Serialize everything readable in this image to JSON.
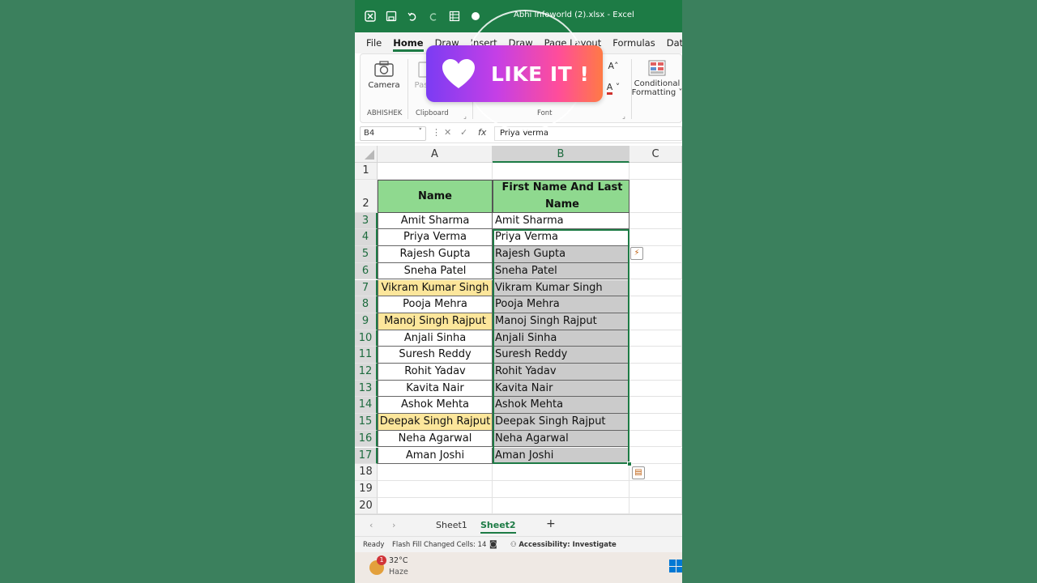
{
  "window": {
    "title": "Abhi Infoworld (2).xlsx  -  Excel",
    "titlebar_icons": [
      "excel-icon",
      "save-icon",
      "undo-icon",
      "redo-icon",
      "form-icon",
      "circle-icon"
    ]
  },
  "ribbon_tabs": [
    "File",
    "Home",
    "Draw",
    "Insert",
    "Draw",
    "Page Layout",
    "Formulas",
    "Data"
  ],
  "ribbon": {
    "camera_label": "Camera",
    "paste_label": "Paste",
    "group_abhishek": "ABHISHEK",
    "group_clipboard": "Clipboard",
    "group_font": "Font",
    "conditional_formatting_line1": "Conditional",
    "conditional_formatting_line2": "Formatting"
  },
  "overlay": {
    "like_text": "LIKE IT !",
    "colors": {
      "gradient_start": "#7b3cf3",
      "gradient_end": "#ff7a45"
    }
  },
  "formula_bar": {
    "name_box": "B4",
    "fx": "fx",
    "value": "Priya Verma"
  },
  "columns": [
    "A",
    "B",
    "C"
  ],
  "rows": [
    {
      "num": "1",
      "a": "",
      "b": ""
    },
    {
      "num": "2",
      "a": "Name",
      "b": "First Name And Last Name"
    },
    {
      "num": "3",
      "a": "Amit Sharma",
      "b": "Amit Sharma"
    },
    {
      "num": "4",
      "a": "Priya Verma",
      "b": "Priya Verma"
    },
    {
      "num": "5",
      "a": "Rajesh Gupta",
      "b": "Rajesh Gupta"
    },
    {
      "num": "6",
      "a": "Sneha Patel",
      "b": "Sneha Patel"
    },
    {
      "num": "7",
      "a": "Vikram Kumar Singh",
      "b": "Vikram Kumar Singh"
    },
    {
      "num": "8",
      "a": "Pooja Mehra",
      "b": "Pooja Mehra"
    },
    {
      "num": "9",
      "a": "Manoj Singh Rajput",
      "b": "Manoj Singh Rajput"
    },
    {
      "num": "10",
      "a": "Anjali Sinha",
      "b": "Anjali Sinha"
    },
    {
      "num": "11",
      "a": "Suresh Reddy",
      "b": "Suresh Reddy"
    },
    {
      "num": "12",
      "a": "Rohit Yadav",
      "b": "Rohit Yadav"
    },
    {
      "num": "13",
      "a": "Kavita Nair",
      "b": "Kavita Nair"
    },
    {
      "num": "14",
      "a": "Ashok Mehta",
      "b": "Ashok Mehta"
    },
    {
      "num": "15",
      "a": "Deepak Singh Rajput",
      "b": "Deepak Singh Rajput"
    },
    {
      "num": "16",
      "a": "Neha Agarwal",
      "b": "Neha Agarwal"
    },
    {
      "num": "17",
      "a": "Aman Joshi",
      "b": "Aman Joshi"
    },
    {
      "num": "18",
      "a": "",
      "b": ""
    },
    {
      "num": "19",
      "a": "",
      "b": ""
    },
    {
      "num": "20",
      "a": "",
      "b": ""
    }
  ],
  "highlighted_rows": [
    "7",
    "9",
    "15"
  ],
  "sheets": [
    "Sheet1",
    "Sheet2"
  ],
  "active_sheet": "Sheet2",
  "add_sheet": "+",
  "status": {
    "ready": "Ready",
    "flash_fill": "Flash Fill Changed Cells: 14",
    "accessibility": "Accessibility: Investigate"
  },
  "taskbar": {
    "temperature": "32°C",
    "condition": "Haze",
    "badge": "1"
  },
  "colors": {
    "excel_green": "#1d7b45",
    "header_fill": "#8fd98f",
    "highlight_yellow": "#fce69b",
    "flash_fill_gray": "#cbcbcb"
  }
}
